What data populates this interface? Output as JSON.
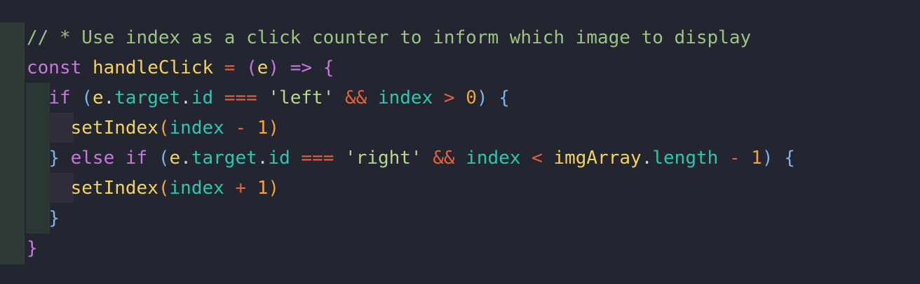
{
  "editor": {
    "lines": [
      {
        "tokens": [
          {
            "t": "comment",
            "v": "// * Use index as a click counter to inform which image to display"
          }
        ]
      },
      {
        "tokens": [
          {
            "t": "kw",
            "v": "const"
          },
          {
            "t": "plain",
            "v": " "
          },
          {
            "t": "fn",
            "v": "handleClick"
          },
          {
            "t": "plain",
            "v": " "
          },
          {
            "t": "op",
            "v": "="
          },
          {
            "t": "plain",
            "v": " "
          },
          {
            "t": "brace-m",
            "v": "("
          },
          {
            "t": "param",
            "v": "e"
          },
          {
            "t": "brace-m",
            "v": ")"
          },
          {
            "t": "plain",
            "v": " "
          },
          {
            "t": "kw",
            "v": "=>"
          },
          {
            "t": "plain",
            "v": " "
          },
          {
            "t": "brace-m",
            "v": "{"
          }
        ]
      },
      {
        "tokens": [
          {
            "t": "plain",
            "v": "  "
          },
          {
            "t": "kw",
            "v": "if"
          },
          {
            "t": "plain",
            "v": " "
          },
          {
            "t": "paren",
            "v": "("
          },
          {
            "t": "param",
            "v": "e"
          },
          {
            "t": "dot",
            "v": "."
          },
          {
            "t": "var",
            "v": "target"
          },
          {
            "t": "dot",
            "v": "."
          },
          {
            "t": "var",
            "v": "id"
          },
          {
            "t": "plain",
            "v": " "
          },
          {
            "t": "op",
            "v": "==="
          },
          {
            "t": "plain",
            "v": " "
          },
          {
            "t": "str",
            "v": "'left'"
          },
          {
            "t": "plain",
            "v": " "
          },
          {
            "t": "op",
            "v": "&&"
          },
          {
            "t": "plain",
            "v": " "
          },
          {
            "t": "var",
            "v": "index"
          },
          {
            "t": "plain",
            "v": " "
          },
          {
            "t": "op",
            "v": ">"
          },
          {
            "t": "plain",
            "v": " "
          },
          {
            "t": "num",
            "v": "0"
          },
          {
            "t": "paren",
            "v": ")"
          },
          {
            "t": "plain",
            "v": " "
          },
          {
            "t": "brace-b",
            "v": "{"
          }
        ]
      },
      {
        "tokens": [
          {
            "t": "plain",
            "v": "    "
          },
          {
            "t": "fn",
            "v": "setIndex"
          },
          {
            "t": "num",
            "v": "("
          },
          {
            "t": "var",
            "v": "index"
          },
          {
            "t": "plain",
            "v": " "
          },
          {
            "t": "op",
            "v": "-"
          },
          {
            "t": "plain",
            "v": " "
          },
          {
            "t": "num",
            "v": "1"
          },
          {
            "t": "num",
            "v": ")"
          }
        ]
      },
      {
        "tokens": [
          {
            "t": "plain",
            "v": "  "
          },
          {
            "t": "brace-b",
            "v": "}"
          },
          {
            "t": "plain",
            "v": " "
          },
          {
            "t": "kw",
            "v": "else"
          },
          {
            "t": "plain",
            "v": " "
          },
          {
            "t": "kw",
            "v": "if"
          },
          {
            "t": "plain",
            "v": " "
          },
          {
            "t": "paren",
            "v": "("
          },
          {
            "t": "param",
            "v": "e"
          },
          {
            "t": "dot",
            "v": "."
          },
          {
            "t": "var",
            "v": "target"
          },
          {
            "t": "dot",
            "v": "."
          },
          {
            "t": "var",
            "v": "id"
          },
          {
            "t": "plain",
            "v": " "
          },
          {
            "t": "op",
            "v": "==="
          },
          {
            "t": "plain",
            "v": " "
          },
          {
            "t": "str",
            "v": "'right'"
          },
          {
            "t": "plain",
            "v": " "
          },
          {
            "t": "op",
            "v": "&&"
          },
          {
            "t": "plain",
            "v": " "
          },
          {
            "t": "var",
            "v": "index"
          },
          {
            "t": "plain",
            "v": " "
          },
          {
            "t": "op",
            "v": "<"
          },
          {
            "t": "plain",
            "v": " "
          },
          {
            "t": "id",
            "v": "imgArray"
          },
          {
            "t": "dot",
            "v": "."
          },
          {
            "t": "var",
            "v": "length"
          },
          {
            "t": "plain",
            "v": " "
          },
          {
            "t": "op",
            "v": "-"
          },
          {
            "t": "plain",
            "v": " "
          },
          {
            "t": "num",
            "v": "1"
          },
          {
            "t": "paren",
            "v": ")"
          },
          {
            "t": "plain",
            "v": " "
          },
          {
            "t": "brace-b",
            "v": "{"
          }
        ]
      },
      {
        "tokens": [
          {
            "t": "plain",
            "v": "    "
          },
          {
            "t": "fn",
            "v": "setIndex"
          },
          {
            "t": "num",
            "v": "("
          },
          {
            "t": "var",
            "v": "index"
          },
          {
            "t": "plain",
            "v": " "
          },
          {
            "t": "op",
            "v": "+"
          },
          {
            "t": "plain",
            "v": " "
          },
          {
            "t": "num",
            "v": "1"
          },
          {
            "t": "num",
            "v": ")"
          }
        ]
      },
      {
        "tokens": [
          {
            "t": "plain",
            "v": "  "
          },
          {
            "t": "brace-b",
            "v": "}"
          }
        ]
      },
      {
        "tokens": [
          {
            "t": "brace-m",
            "v": "}"
          }
        ]
      }
    ]
  }
}
